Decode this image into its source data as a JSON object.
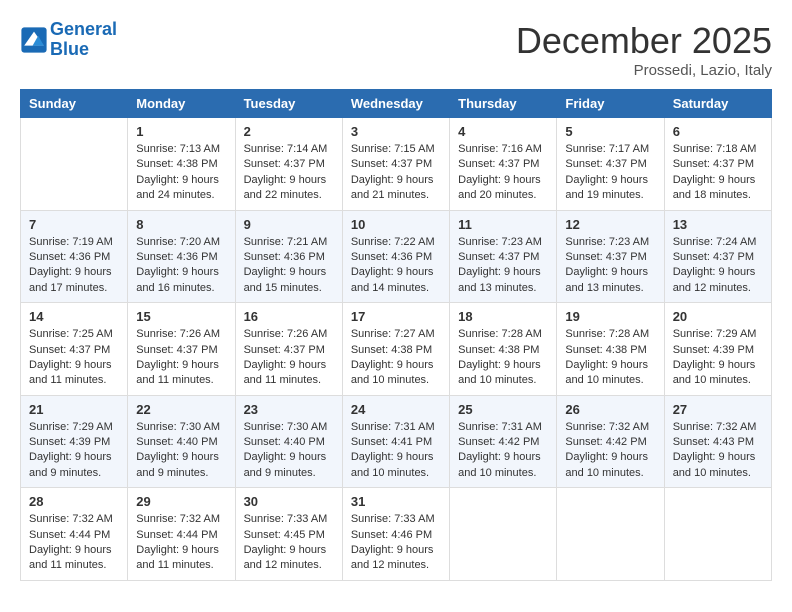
{
  "header": {
    "logo_line1": "General",
    "logo_line2": "Blue",
    "month": "December 2025",
    "location": "Prossedi, Lazio, Italy"
  },
  "days_of_week": [
    "Sunday",
    "Monday",
    "Tuesday",
    "Wednesday",
    "Thursday",
    "Friday",
    "Saturday"
  ],
  "weeks": [
    [
      {
        "day": "",
        "content": ""
      },
      {
        "day": "1",
        "content": "Sunrise: 7:13 AM\nSunset: 4:38 PM\nDaylight: 9 hours and 24 minutes."
      },
      {
        "day": "2",
        "content": "Sunrise: 7:14 AM\nSunset: 4:37 PM\nDaylight: 9 hours and 22 minutes."
      },
      {
        "day": "3",
        "content": "Sunrise: 7:15 AM\nSunset: 4:37 PM\nDaylight: 9 hours and 21 minutes."
      },
      {
        "day": "4",
        "content": "Sunrise: 7:16 AM\nSunset: 4:37 PM\nDaylight: 9 hours and 20 minutes."
      },
      {
        "day": "5",
        "content": "Sunrise: 7:17 AM\nSunset: 4:37 PM\nDaylight: 9 hours and 19 minutes."
      },
      {
        "day": "6",
        "content": "Sunrise: 7:18 AM\nSunset: 4:37 PM\nDaylight: 9 hours and 18 minutes."
      }
    ],
    [
      {
        "day": "7",
        "content": "Sunrise: 7:19 AM\nSunset: 4:36 PM\nDaylight: 9 hours and 17 minutes."
      },
      {
        "day": "8",
        "content": "Sunrise: 7:20 AM\nSunset: 4:36 PM\nDaylight: 9 hours and 16 minutes."
      },
      {
        "day": "9",
        "content": "Sunrise: 7:21 AM\nSunset: 4:36 PM\nDaylight: 9 hours and 15 minutes."
      },
      {
        "day": "10",
        "content": "Sunrise: 7:22 AM\nSunset: 4:36 PM\nDaylight: 9 hours and 14 minutes."
      },
      {
        "day": "11",
        "content": "Sunrise: 7:23 AM\nSunset: 4:37 PM\nDaylight: 9 hours and 13 minutes."
      },
      {
        "day": "12",
        "content": "Sunrise: 7:23 AM\nSunset: 4:37 PM\nDaylight: 9 hours and 13 minutes."
      },
      {
        "day": "13",
        "content": "Sunrise: 7:24 AM\nSunset: 4:37 PM\nDaylight: 9 hours and 12 minutes."
      }
    ],
    [
      {
        "day": "14",
        "content": "Sunrise: 7:25 AM\nSunset: 4:37 PM\nDaylight: 9 hours and 11 minutes."
      },
      {
        "day": "15",
        "content": "Sunrise: 7:26 AM\nSunset: 4:37 PM\nDaylight: 9 hours and 11 minutes."
      },
      {
        "day": "16",
        "content": "Sunrise: 7:26 AM\nSunset: 4:37 PM\nDaylight: 9 hours and 11 minutes."
      },
      {
        "day": "17",
        "content": "Sunrise: 7:27 AM\nSunset: 4:38 PM\nDaylight: 9 hours and 10 minutes."
      },
      {
        "day": "18",
        "content": "Sunrise: 7:28 AM\nSunset: 4:38 PM\nDaylight: 9 hours and 10 minutes."
      },
      {
        "day": "19",
        "content": "Sunrise: 7:28 AM\nSunset: 4:38 PM\nDaylight: 9 hours and 10 minutes."
      },
      {
        "day": "20",
        "content": "Sunrise: 7:29 AM\nSunset: 4:39 PM\nDaylight: 9 hours and 10 minutes."
      }
    ],
    [
      {
        "day": "21",
        "content": "Sunrise: 7:29 AM\nSunset: 4:39 PM\nDaylight: 9 hours and 9 minutes."
      },
      {
        "day": "22",
        "content": "Sunrise: 7:30 AM\nSunset: 4:40 PM\nDaylight: 9 hours and 9 minutes."
      },
      {
        "day": "23",
        "content": "Sunrise: 7:30 AM\nSunset: 4:40 PM\nDaylight: 9 hours and 9 minutes."
      },
      {
        "day": "24",
        "content": "Sunrise: 7:31 AM\nSunset: 4:41 PM\nDaylight: 9 hours and 10 minutes."
      },
      {
        "day": "25",
        "content": "Sunrise: 7:31 AM\nSunset: 4:42 PM\nDaylight: 9 hours and 10 minutes."
      },
      {
        "day": "26",
        "content": "Sunrise: 7:32 AM\nSunset: 4:42 PM\nDaylight: 9 hours and 10 minutes."
      },
      {
        "day": "27",
        "content": "Sunrise: 7:32 AM\nSunset: 4:43 PM\nDaylight: 9 hours and 10 minutes."
      }
    ],
    [
      {
        "day": "28",
        "content": "Sunrise: 7:32 AM\nSunset: 4:44 PM\nDaylight: 9 hours and 11 minutes."
      },
      {
        "day": "29",
        "content": "Sunrise: 7:32 AM\nSunset: 4:44 PM\nDaylight: 9 hours and 11 minutes."
      },
      {
        "day": "30",
        "content": "Sunrise: 7:33 AM\nSunset: 4:45 PM\nDaylight: 9 hours and 12 minutes."
      },
      {
        "day": "31",
        "content": "Sunrise: 7:33 AM\nSunset: 4:46 PM\nDaylight: 9 hours and 12 minutes."
      },
      {
        "day": "",
        "content": ""
      },
      {
        "day": "",
        "content": ""
      },
      {
        "day": "",
        "content": ""
      }
    ]
  ]
}
